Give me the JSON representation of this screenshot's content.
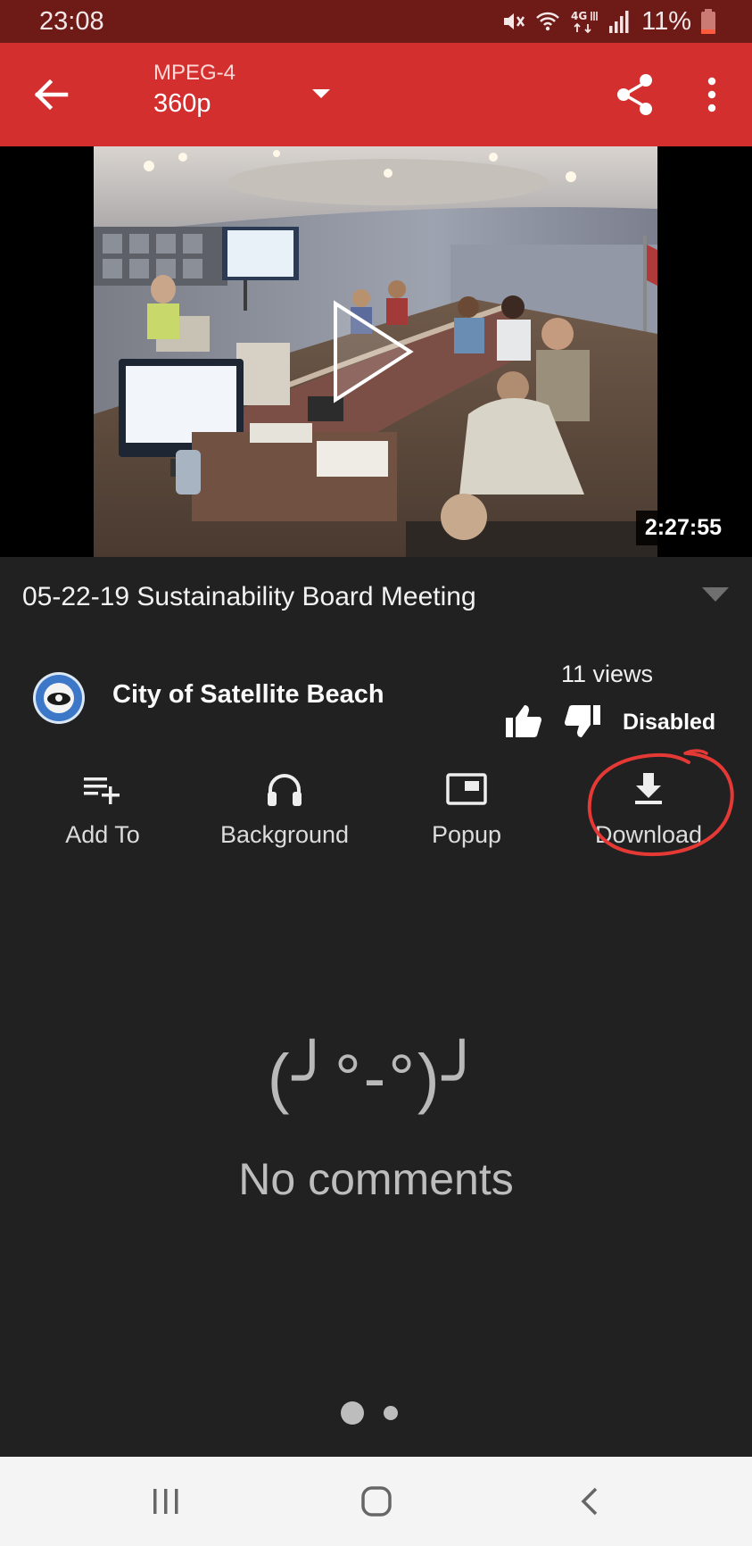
{
  "status_bar": {
    "time": "23:08",
    "battery": "11%",
    "icons": [
      "mute-vibrate-icon",
      "wifi-icon",
      "lte-icon",
      "signal-icon",
      "battery-icon"
    ]
  },
  "toolbar": {
    "back_icon": "arrow-back-icon",
    "format": "MPEG-4",
    "resolution": "360p",
    "dropdown_icon": "arrow-drop-down-icon",
    "share_icon": "share-icon",
    "more_icon": "more-vert-icon"
  },
  "video": {
    "duration": "2:27:55",
    "play_icon": "play-icon"
  },
  "details": {
    "title": "05-22-19 Sustainability Board Meeting",
    "channel_name": "City of Satellite Beach",
    "views": "11 views",
    "rating_status": "Disabled"
  },
  "actions": [
    {
      "label": "Add To",
      "icon": "playlist-add-icon"
    },
    {
      "label": "Background",
      "icon": "headphones-icon"
    },
    {
      "label": "Popup",
      "icon": "picture-in-picture-icon"
    },
    {
      "label": "Download",
      "icon": "download-icon"
    }
  ],
  "comments": {
    "emoticon": "(╯°-°)╯",
    "message": "No comments"
  },
  "colors": {
    "status_bar": "#6e1a17",
    "toolbar": "#d32f2f",
    "background": "#212121",
    "highlight_circle": "#e53935",
    "nav_bar": "#f4f4f4"
  }
}
